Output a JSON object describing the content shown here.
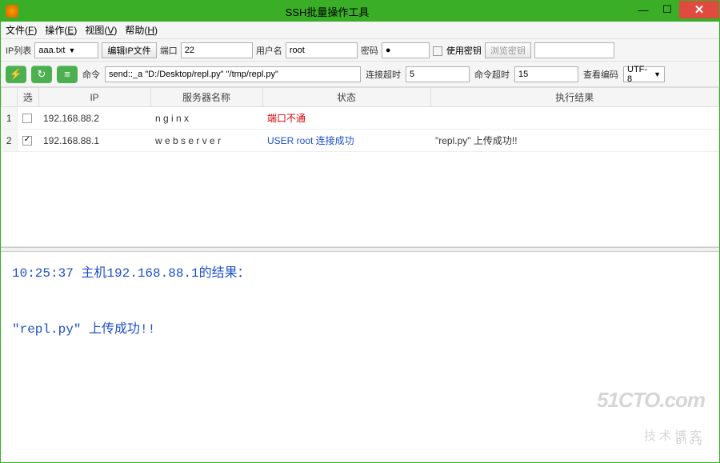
{
  "window": {
    "title": "SSH批量操作工具"
  },
  "menu": {
    "file": "文件(F)",
    "operate": "操作(E)",
    "view": "视图(V)",
    "help": "帮助(H)"
  },
  "toolbar": {
    "ip_list_label": "IP列表",
    "ip_list_value": "aaa.txt",
    "edit_ip_btn": "编辑IP文件",
    "port_label": "端口",
    "port_value": "22",
    "user_label": "用户名",
    "user_value": "root",
    "pwd_label": "密码",
    "pwd_value": "●",
    "use_key_label": " 使用密钥",
    "browse_key_btn": "浏览密钥"
  },
  "cmdbar": {
    "cmd_label": "命令",
    "cmd_value": "send::_a \"D:/Desktop/repl.py\" \"/tmp/repl.py\"",
    "conn_to_label": "连接超时",
    "conn_to_value": "5",
    "cmd_to_label": "命令超时",
    "cmd_to_value": "15",
    "enc_label": "查看编码",
    "enc_value": "UTF-8"
  },
  "table": {
    "headers": {
      "sel": "选",
      "ip": "IP",
      "server": "服务器名称",
      "status": "状态",
      "result": "执行结果"
    },
    "rows": [
      {
        "n": "1",
        "checked": false,
        "ip": "192.168.88.2",
        "server": "n g i n x",
        "status": "端口不通",
        "status_cls": "st-red",
        "result": ""
      },
      {
        "n": "2",
        "checked": true,
        "ip": "192.168.88.1",
        "server": "w e b s e r v e r",
        "status": "USER root 连接成功",
        "status_cls": "st-blue",
        "result": "\"repl.py\" 上传成功!!"
      }
    ]
  },
  "log": {
    "line1": "10:25:37 主机192.168.88.1的结果：",
    "line2": "\"repl.py\" 上传成功!!"
  },
  "watermark": {
    "big": "51CTO.com",
    "small": "技术博客",
    "blog": "Blog"
  }
}
